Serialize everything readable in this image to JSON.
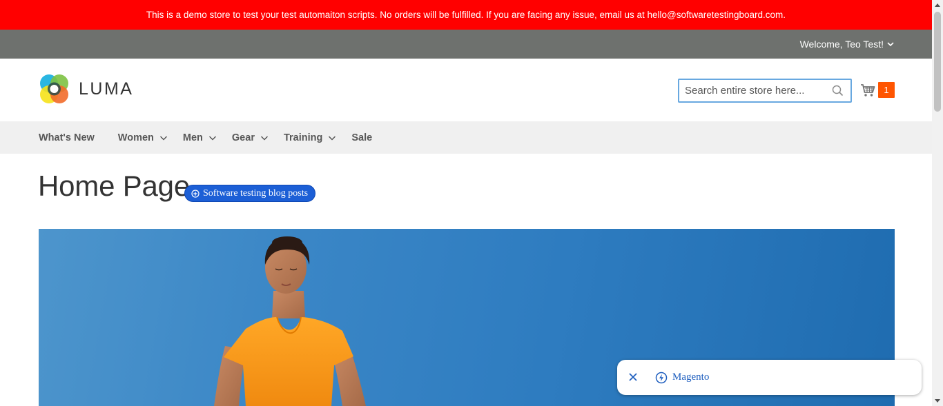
{
  "notice": {
    "text": "This is a demo store to test your test automaiton scripts. No orders will be fulfilled. If you are facing any issue, email us at hello@softwaretestingboard.com."
  },
  "account": {
    "welcome": "Welcome, Teo Test!"
  },
  "brand": {
    "name": "LUMA"
  },
  "search": {
    "placeholder": "Search entire store here...",
    "value": ""
  },
  "cart": {
    "count": "1"
  },
  "nav": {
    "items": [
      {
        "label": "What's New",
        "has_dropdown": false
      },
      {
        "label": "Women",
        "has_dropdown": true
      },
      {
        "label": "Men",
        "has_dropdown": true
      },
      {
        "label": "Gear",
        "has_dropdown": true
      },
      {
        "label": "Training",
        "has_dropdown": true
      },
      {
        "label": "Sale",
        "has_dropdown": false
      }
    ]
  },
  "page": {
    "title": "Home Page",
    "blog_link": "Software testing blog posts"
  },
  "popup": {
    "label": "Magento"
  },
  "colors": {
    "notice_bg": "#ff0000",
    "welcome_bg": "#6e716e",
    "nav_bg": "#f0f0f0",
    "cart_badge": "#ff5501",
    "blog_pill": "#1c5fd6",
    "link_blue": "#1f5fbf",
    "hero_sky": "#2e7cc0",
    "shirt_orange": "#ff9d1f"
  },
  "icons": {
    "welcome_caret": "chevron-down-icon",
    "search": "search-icon",
    "cart": "cart-icon",
    "nav_caret": "chevron-down-icon",
    "blog_pill": "plus-circle-icon",
    "popup_close": "close-icon",
    "popup_bolt": "bolt-icon"
  }
}
